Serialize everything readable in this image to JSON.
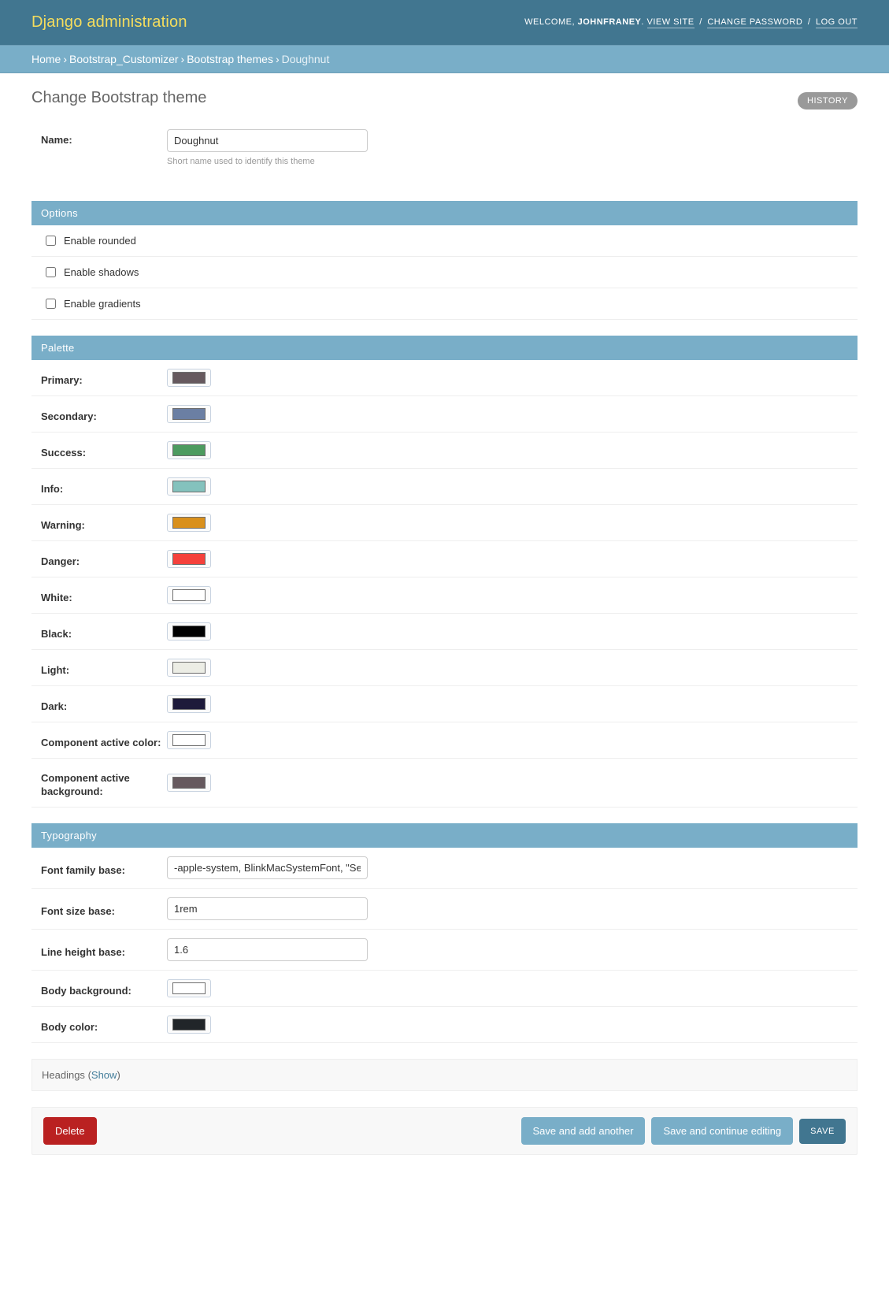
{
  "header": {
    "branding": "Django administration",
    "welcome_prefix": "WELCOME,",
    "username": "JOHNFRANEY",
    "period": ".",
    "view_site": "VIEW SITE",
    "change_password": "CHANGE PASSWORD",
    "log_out": "LOG OUT",
    "separator": "/"
  },
  "breadcrumbs": {
    "items": [
      {
        "label": "Home",
        "current": false
      },
      {
        "label": "Bootstrap_Customizer",
        "current": false
      },
      {
        "label": "Bootstrap themes",
        "current": false
      },
      {
        "label": "Doughnut",
        "current": true
      }
    ],
    "separator": "›"
  },
  "content": {
    "page_title": "Change Bootstrap theme",
    "history_button": "HISTORY"
  },
  "name_field": {
    "label": "Name:",
    "value": "Doughnut",
    "placeholder": "",
    "help_text": "Short name used to identify this theme"
  },
  "options": {
    "heading": "Options",
    "items": [
      {
        "label": "Enable rounded",
        "checked": false
      },
      {
        "label": "Enable shadows",
        "checked": false
      },
      {
        "label": "Enable gradients",
        "checked": false
      }
    ]
  },
  "palette": {
    "heading": "Palette",
    "items": [
      {
        "label": "Primary:",
        "color": "#66595e"
      },
      {
        "label": "Secondary:",
        "color": "#6b7fa3"
      },
      {
        "label": "Success:",
        "color": "#4d9b5f"
      },
      {
        "label": "Info:",
        "color": "#84c2bd"
      },
      {
        "label": "Warning:",
        "color": "#d9901c"
      },
      {
        "label": "Danger:",
        "color": "#f5413c"
      },
      {
        "label": "White:",
        "color": "#ffffff"
      },
      {
        "label": "Black:",
        "color": "#000000"
      },
      {
        "label": "Light:",
        "color": "#ecedE5"
      },
      {
        "label": "Dark:",
        "color": "#1d1a3a"
      },
      {
        "label": "Component active color:",
        "color": "#ffffff"
      },
      {
        "label": "Component active background:",
        "color": "#66595e"
      }
    ]
  },
  "typography": {
    "heading": "Typography",
    "fields": [
      {
        "label": "Font family base:",
        "type": "text",
        "value": "-apple-system, BlinkMacSystemFont, \"Segoe"
      },
      {
        "label": "Font size base:",
        "type": "text",
        "value": "1rem"
      },
      {
        "label": "Line height base:",
        "type": "text",
        "value": "1.6"
      },
      {
        "label": "Body background:",
        "type": "color",
        "color": "#ffffff"
      },
      {
        "label": "Body color:",
        "type": "color",
        "color": "#212529"
      }
    ]
  },
  "headings_section": {
    "label": "Headings",
    "toggle_open": "(",
    "toggle_label": "Show",
    "toggle_close": ")"
  },
  "submit_row": {
    "delete_label": "Delete",
    "save_add_another_label": "Save and add another",
    "save_continue_label": "Save and continue editing",
    "save_label": "SAVE"
  }
}
